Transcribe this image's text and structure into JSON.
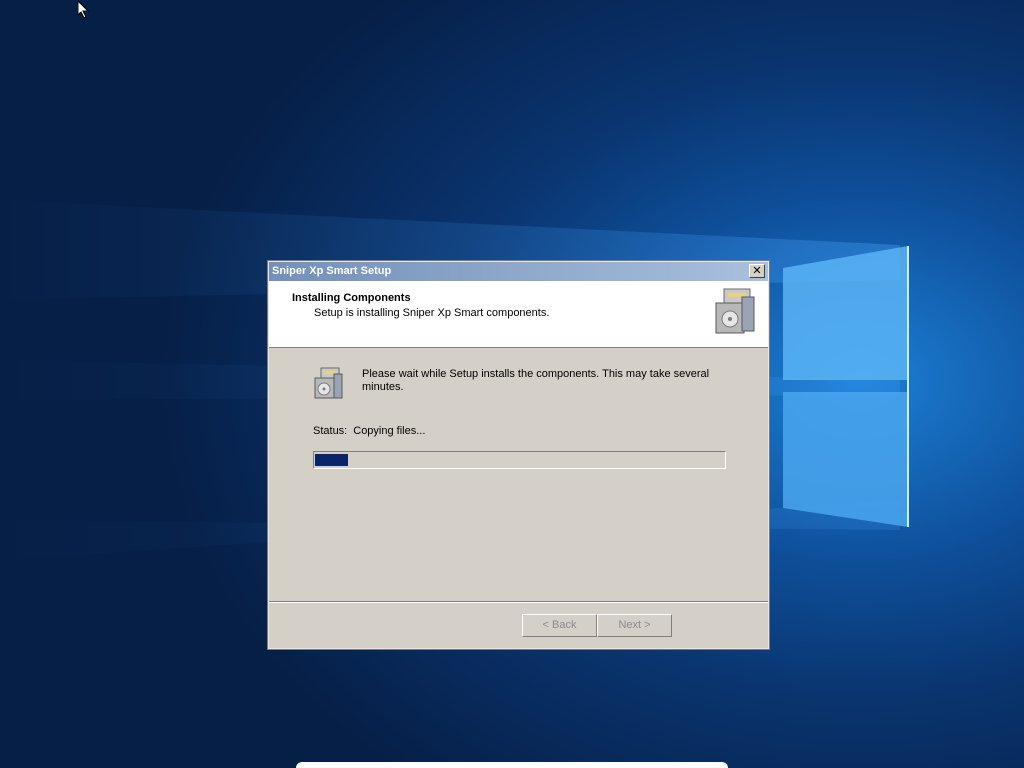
{
  "window": {
    "title": "Sniper Xp Smart Setup",
    "close_glyph": "✕"
  },
  "header": {
    "title": "Installing Components",
    "subtitle": "Setup is installing Sniper Xp Smart components.",
    "icon": "installer-box-icon"
  },
  "body": {
    "icon": "installer-box-icon",
    "message": "Please wait while Setup installs the components.  This may take several minutes.",
    "status_label": "Status:",
    "status_value": "Copying files...",
    "progress": 0.08
  },
  "buttons": {
    "back": "< Back",
    "next": "Next >",
    "back_enabled": false,
    "next_enabled": false
  },
  "colors": {
    "title_bar_start": "#7490b8",
    "title_bar_end": "#a9c0de",
    "dialog_bg": "#d4d0c8",
    "progress_fill": "#0a246a",
    "disabled_text": "#8a8a8a"
  }
}
